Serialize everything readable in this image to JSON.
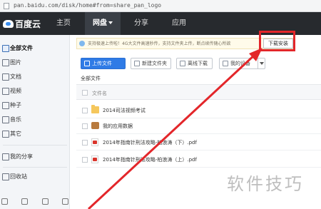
{
  "browser": {
    "url": "pan.baidu.com/disk/home#from=share_pan_logo"
  },
  "topnav": {
    "logo_text": "百度云",
    "items": [
      {
        "label": "主页"
      },
      {
        "label": "网盘"
      },
      {
        "label": "分享"
      },
      {
        "label": "应用"
      }
    ]
  },
  "sidebar": {
    "items": [
      {
        "label": "全部文件"
      },
      {
        "label": "图片"
      },
      {
        "label": "文档"
      },
      {
        "label": "视频"
      },
      {
        "label": "种子"
      },
      {
        "label": "音乐"
      },
      {
        "label": "其它"
      },
      {
        "label": "我的分享"
      },
      {
        "label": "回收站"
      }
    ]
  },
  "notice": {
    "message": "支持极速上传啦！4G大文件高速秒传，支持文件夹上传，断点续传随心所欲",
    "download_button": "下载安装"
  },
  "toolbar": {
    "upload": "上传文件",
    "new_folder": "新建文件夹",
    "offline_download": "离线下载",
    "my_devices": "我的设备"
  },
  "breadcrumb": "全部文件",
  "table": {
    "header": "文件名",
    "rows": [
      {
        "name": "2014司法视频考试",
        "icon": "folder-icon"
      },
      {
        "name": "我的应用数据",
        "icon": "app-data-icon"
      },
      {
        "name": "2014年指南针刑法攻略-柏浪涛（下）.pdf",
        "icon": "pdf-icon"
      },
      {
        "name": "2014年指南针刑法攻略-柏浪涛（上）.pdf",
        "icon": "pdf-icon"
      }
    ]
  },
  "watermark": "软件技巧",
  "colors": {
    "nav_bg": "#272a2e",
    "primary_blue": "#2f7be6",
    "annotation_red": "#e3262a",
    "notice_bg": "#fffbea"
  }
}
